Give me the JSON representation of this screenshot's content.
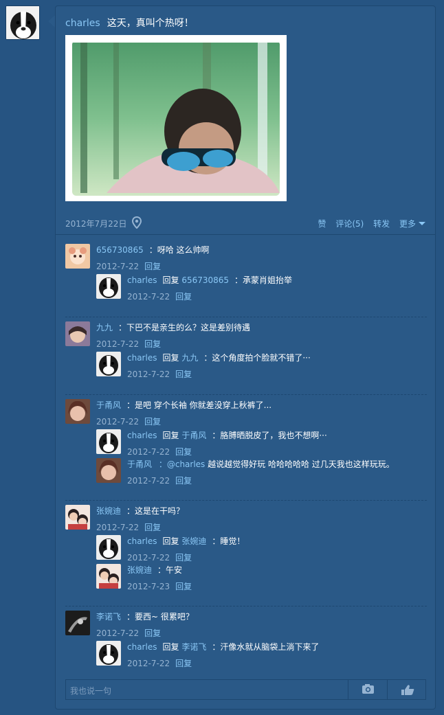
{
  "post": {
    "username": "charles",
    "text": "这天，真叫个热呀！",
    "date": "2012年7月22日",
    "actions": {
      "like": "赞",
      "comment": "评论(5)",
      "repost": "转发",
      "more": "更多"
    }
  },
  "comments": [
    {
      "user": "656730865",
      "text": "：呀哈 这么帅啊",
      "date": "2012-7-22",
      "reply_label": "回复",
      "replies": [
        {
          "user": "charles",
          "reply_word": "回复",
          "target": "656730865",
          "text": "：承蒙肖姐抬举",
          "date": "2012-7-22",
          "reply_label": "回复"
        }
      ]
    },
    {
      "user": "九九",
      "text": "：下巴不是亲生的么？这是差别待遇",
      "date": "2012-7-22",
      "reply_label": "回复",
      "replies": [
        {
          "user": "charles",
          "reply_word": "回复",
          "target": "九九",
          "text": "：这个角度拍个脸就不错了···",
          "date": "2012-7-22",
          "reply_label": "回复"
        }
      ]
    },
    {
      "user": "于甬风",
      "text": "：是吧 穿个长袖 你就差没穿上秋裤了...",
      "date": "2012-7-22",
      "reply_label": "回复",
      "replies": [
        {
          "user": "charles",
          "reply_word": "回复",
          "target": "于甬风",
          "text": "：胳膊晒脱皮了，我也不想啊···",
          "date": "2012-7-22",
          "reply_label": "回复"
        },
        {
          "user": "于甬风",
          "reply_word": "",
          "target": "：@charles",
          "text": "越说越觉得好玩 哈哈哈哈哈 过几天我也这样玩玩。",
          "date": "2012-7-22",
          "reply_label": "回复"
        }
      ]
    },
    {
      "user": "张婉迪",
      "text": "：这是在干吗？",
      "date": "2012-7-22",
      "reply_label": "回复",
      "replies": [
        {
          "user": "charles",
          "reply_word": "回复",
          "target": "张婉迪",
          "text": "：睡觉！",
          "date": "2012-7-22",
          "reply_label": "回复"
        },
        {
          "user": "张婉迪",
          "reply_word": "",
          "target": "",
          "text": "：午安",
          "date": "2012-7-23",
          "reply_label": "回复"
        }
      ]
    },
    {
      "user": "李诺飞",
      "text": "：要西~ 很累吧？",
      "date": "2012-7-22",
      "reply_label": "回复",
      "replies": [
        {
          "user": "charles",
          "reply_word": "回复",
          "target": "李诺飞",
          "text": "：汗像水就从脑袋上淌下来了",
          "date": "2012-7-22",
          "reply_label": "回复"
        }
      ]
    }
  ],
  "input": {
    "placeholder": "我也说一句"
  },
  "icons": {
    "pin": "location-pin-icon",
    "camera": "camera-icon",
    "like": "thumbs-up-icon",
    "more": "chevron-down-icon"
  }
}
